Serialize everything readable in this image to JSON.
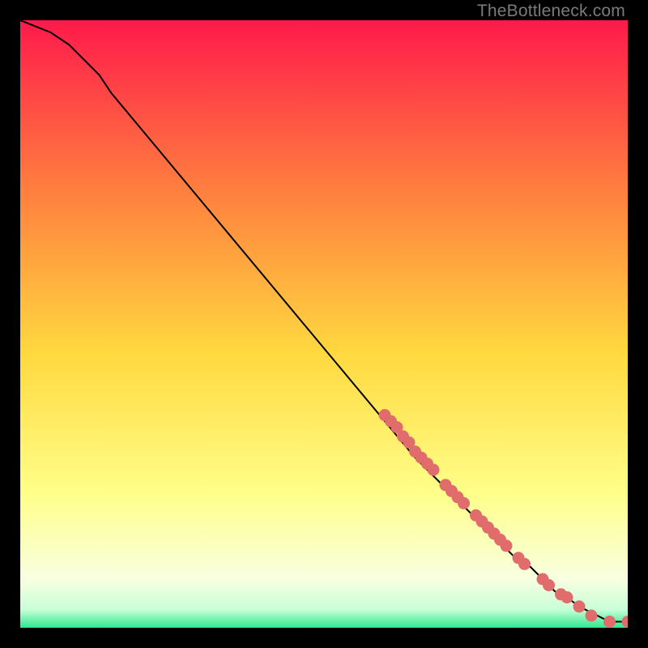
{
  "watermark": "TheBottleneck.com",
  "colors": {
    "frame": "#000000",
    "grad_top": "#ff1a4b",
    "grad_mid_upper": "#ff7f3f",
    "grad_mid": "#ffd93f",
    "grad_mid_lower": "#ffff8a",
    "grad_near_bottom": "#f8ffe0",
    "grad_green": "#2ee88f",
    "line": "#000000",
    "marker_fill": "#e06c6c",
    "marker_stroke": "#b84f4f"
  },
  "chart_data": {
    "type": "line",
    "title": "",
    "xlabel": "",
    "ylabel": "",
    "xlim": [
      0,
      100
    ],
    "ylim": [
      0,
      100
    ],
    "grid": false,
    "legend": false,
    "series": [
      {
        "name": "curve",
        "x": [
          0,
          5,
          8,
          10,
          13,
          15,
          20,
          30,
          40,
          50,
          60,
          65,
          67,
          70,
          72,
          74,
          76,
          78,
          80,
          82,
          84,
          86,
          88,
          90,
          92,
          94,
          95,
          96,
          97,
          98,
          100
        ],
        "y": [
          100,
          98,
          96,
          94,
          91,
          88,
          82,
          70,
          58,
          46,
          34,
          28,
          26,
          23,
          21,
          19,
          17,
          15,
          13,
          11,
          10,
          8,
          6,
          5,
          3.5,
          2.5,
          2,
          1.5,
          1.2,
          1,
          1
        ]
      }
    ],
    "markers": [
      {
        "x": 60.0,
        "y": 35.0
      },
      {
        "x": 61.0,
        "y": 34.0
      },
      {
        "x": 62.0,
        "y": 33.0
      },
      {
        "x": 63.0,
        "y": 31.5
      },
      {
        "x": 64.0,
        "y": 30.5
      },
      {
        "x": 65.0,
        "y": 29.0
      },
      {
        "x": 66.0,
        "y": 28.0
      },
      {
        "x": 67.0,
        "y": 27.0
      },
      {
        "x": 68.0,
        "y": 26.0
      },
      {
        "x": 70.0,
        "y": 23.5
      },
      {
        "x": 71.0,
        "y": 22.5
      },
      {
        "x": 72.0,
        "y": 21.5
      },
      {
        "x": 73.0,
        "y": 20.5
      },
      {
        "x": 75.0,
        "y": 18.5
      },
      {
        "x": 76.0,
        "y": 17.5
      },
      {
        "x": 77.0,
        "y": 16.5
      },
      {
        "x": 78.0,
        "y": 15.5
      },
      {
        "x": 79.0,
        "y": 14.5
      },
      {
        "x": 80.0,
        "y": 13.5
      },
      {
        "x": 82.0,
        "y": 11.5
      },
      {
        "x": 83.0,
        "y": 10.5
      },
      {
        "x": 86.0,
        "y": 8.0
      },
      {
        "x": 87.0,
        "y": 7.0
      },
      {
        "x": 89.0,
        "y": 5.5
      },
      {
        "x": 90.0,
        "y": 5.0
      },
      {
        "x": 92.0,
        "y": 3.5
      },
      {
        "x": 94.0,
        "y": 2.0
      },
      {
        "x": 97.0,
        "y": 1.0
      },
      {
        "x": 100.0,
        "y": 1.0
      }
    ]
  }
}
